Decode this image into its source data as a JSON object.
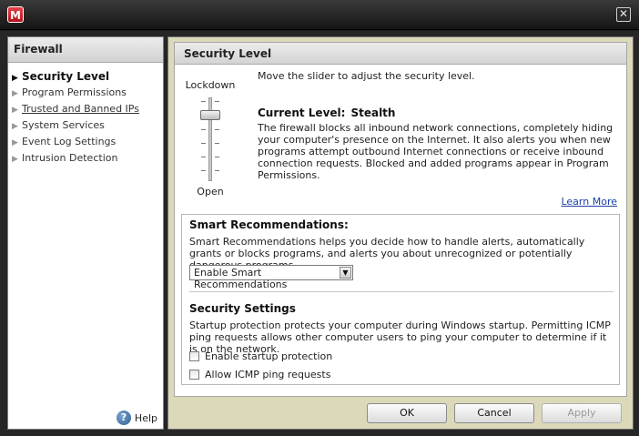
{
  "window": {
    "logo_letter": "M",
    "close_glyph": "✕",
    "logo_icon": "mcafee-logo-icon",
    "close_icon": "close-icon"
  },
  "sidebar": {
    "title": "Firewall",
    "items": [
      {
        "label": "Security Level",
        "active": true
      },
      {
        "label": "Program Permissions",
        "active": false
      },
      {
        "label": "Trusted and Banned IPs",
        "active": false
      },
      {
        "label": "System Services",
        "active": false
      },
      {
        "label": "Event Log Settings",
        "active": false
      },
      {
        "label": "Intrusion Detection",
        "active": false
      }
    ],
    "help_label": "Help",
    "help_glyph": "?"
  },
  "panel": {
    "title": "Security Level",
    "slider": {
      "top_label": "Lockdown",
      "bottom_label": "Open"
    },
    "instruction": "Move the slider to adjust the security level.",
    "current_level_label": "Current Level:",
    "current_level_value": "Stealth",
    "description": "The firewall blocks all inbound network connections, completely hiding your computer's presence on the Internet. It also alerts you when new programs attempt outbound Internet connections or receive inbound connection requests. Blocked and added programs appear in Program Permissions.",
    "learn_more": "Learn More",
    "smart": {
      "title": "Smart Recommendations:",
      "text": "Smart Recommendations helps you decide how to handle alerts, automatically grants or blocks programs, and alerts you about unrecognized or potentially dangerous programs.",
      "dropdown_value": "Enable Smart Recommendations",
      "dropdown_arrow": "▼"
    },
    "settings": {
      "title": "Security Settings",
      "text": "Startup protection protects your computer during Windows startup. Permitting ICMP ping requests allows other computer users to ping your computer to determine if it is on the network.",
      "startup_label": "Enable startup protection",
      "icmp_label": "Allow ICMP ping requests"
    }
  },
  "buttons": {
    "ok": "OK",
    "cancel": "Cancel",
    "apply": "Apply"
  }
}
